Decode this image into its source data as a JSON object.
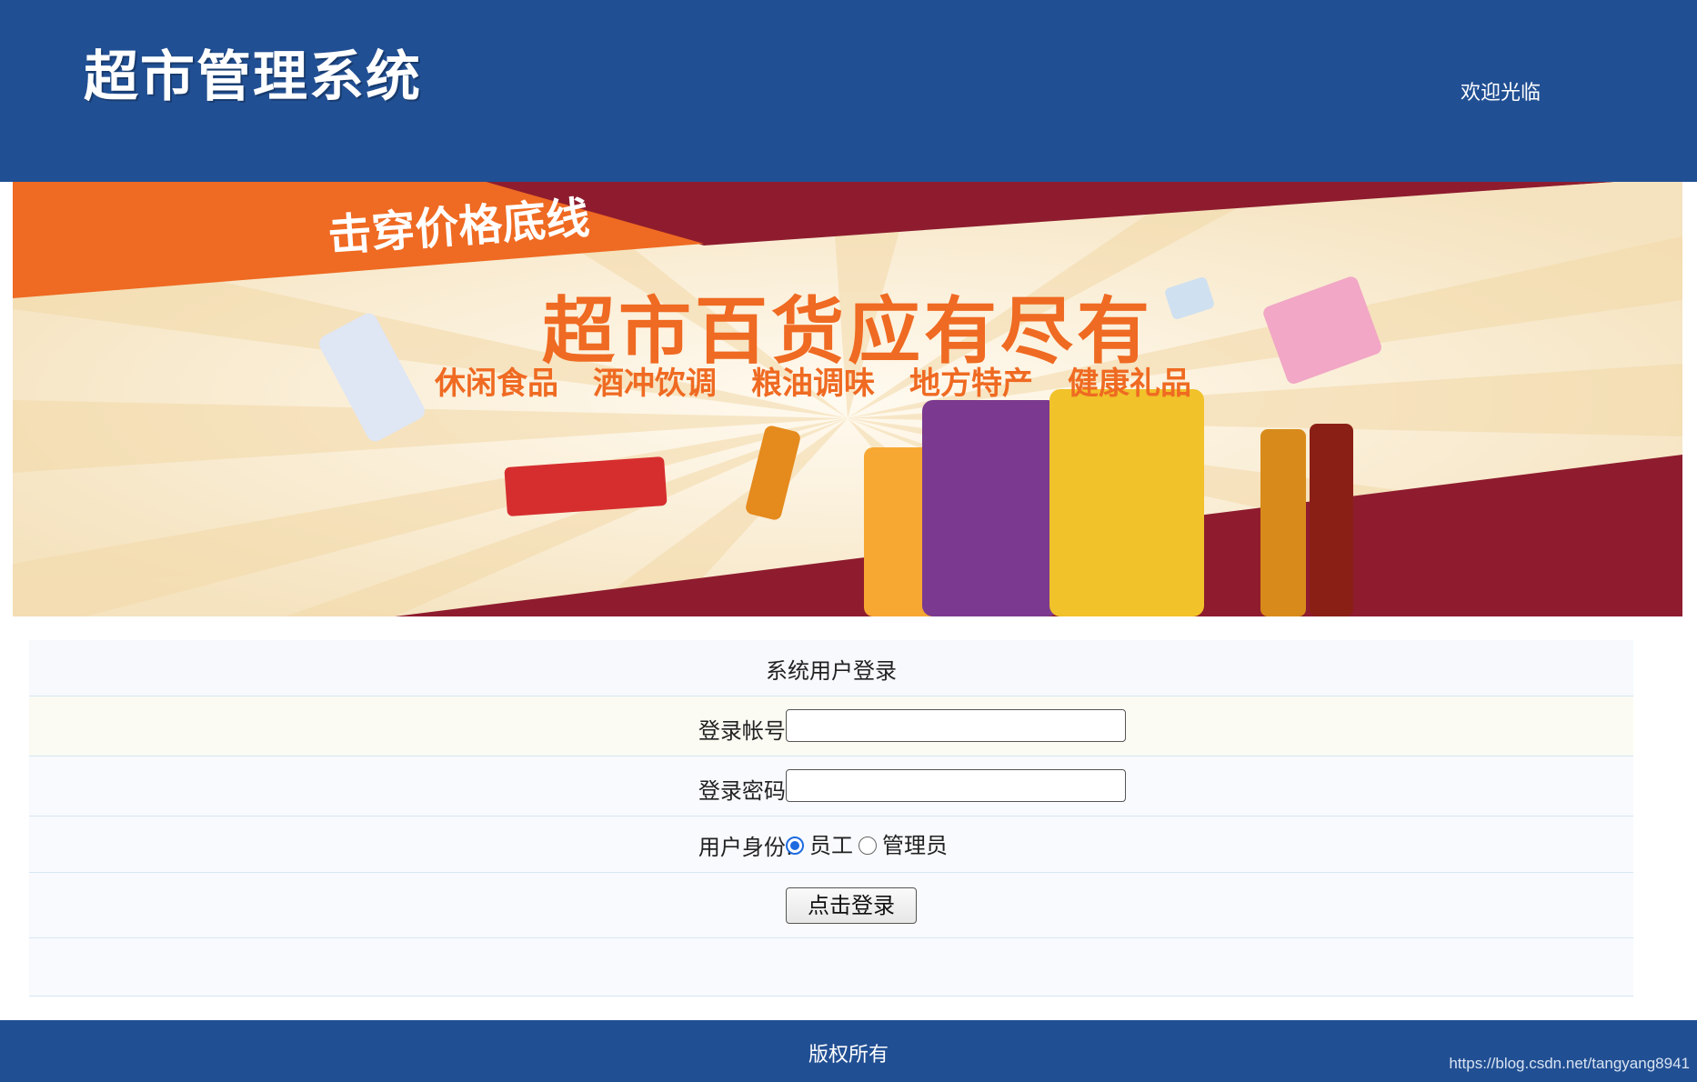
{
  "header": {
    "title": "超市管理系统",
    "welcome": "欢迎光临"
  },
  "banner": {
    "slogan": "击穿价格底线",
    "tagline": "超市百货应有尽有",
    "categories": [
      "休闲食品",
      "酒冲饮调",
      "粮油调味",
      "地方特产",
      "健康礼品"
    ],
    "colors": {
      "orange": "#ef6a22",
      "red": "#8e1c2e",
      "cream": "#fbf4df"
    }
  },
  "login": {
    "title": "系统用户登录",
    "account_label": "登录帐号:",
    "account_value": "",
    "password_label": "登录密码:",
    "password_value": "",
    "identity_label": "用户身份:",
    "roles": [
      {
        "label": "员工",
        "checked": true
      },
      {
        "label": "管理员",
        "checked": false
      }
    ],
    "submit_label": "点击登录"
  },
  "footer": {
    "copyright": "版权所有",
    "watermark": "https://blog.csdn.net/tangyang8941"
  },
  "colors": {
    "primary": "#214f93",
    "radio_accent": "#1e6be0"
  }
}
